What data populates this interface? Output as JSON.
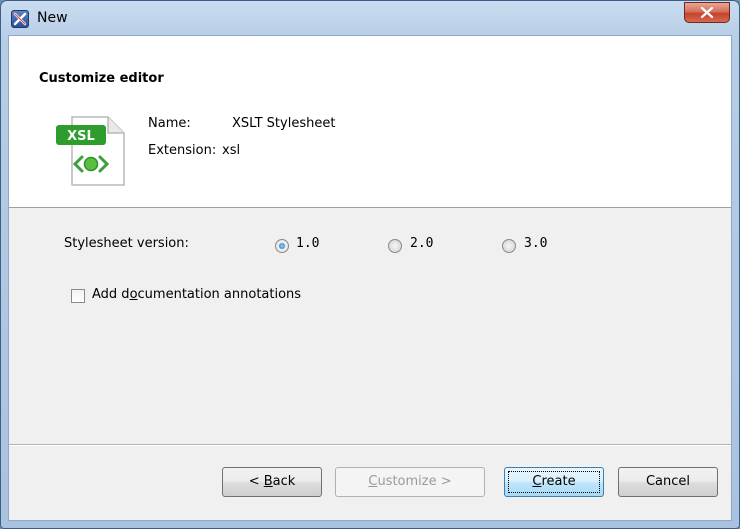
{
  "window": {
    "title": "New",
    "close_label": "X"
  },
  "header": {
    "title": "Customize editor",
    "name_label": "Name:",
    "name_value": "XSLT Stylesheet",
    "extension_label": "Extension:",
    "extension_value": "xsl",
    "file_icon_badge": "XSL"
  },
  "options": {
    "version_label": "Stylesheet version:",
    "versions": [
      {
        "label": "1.0",
        "selected": true
      },
      {
        "label": "2.0",
        "selected": false
      },
      {
        "label": "3.0",
        "selected": false
      }
    ],
    "add_doc_label_pre": "Add d",
    "add_doc_label_mnemonic": "o",
    "add_doc_label_post": "cumentation annotations",
    "add_doc_checked": false
  },
  "buttons": {
    "back_pre": "< ",
    "back_mnemonic": "B",
    "back_post": "ack",
    "customize_mnemonic": "C",
    "customize_post": "ustomize >",
    "customize_enabled": false,
    "create_mnemonic": "C",
    "create_post": "reate",
    "cancel": "Cancel"
  },
  "colors": {
    "badge_green": "#2e9d2e",
    "radio_selected": "#1e6fbd"
  }
}
